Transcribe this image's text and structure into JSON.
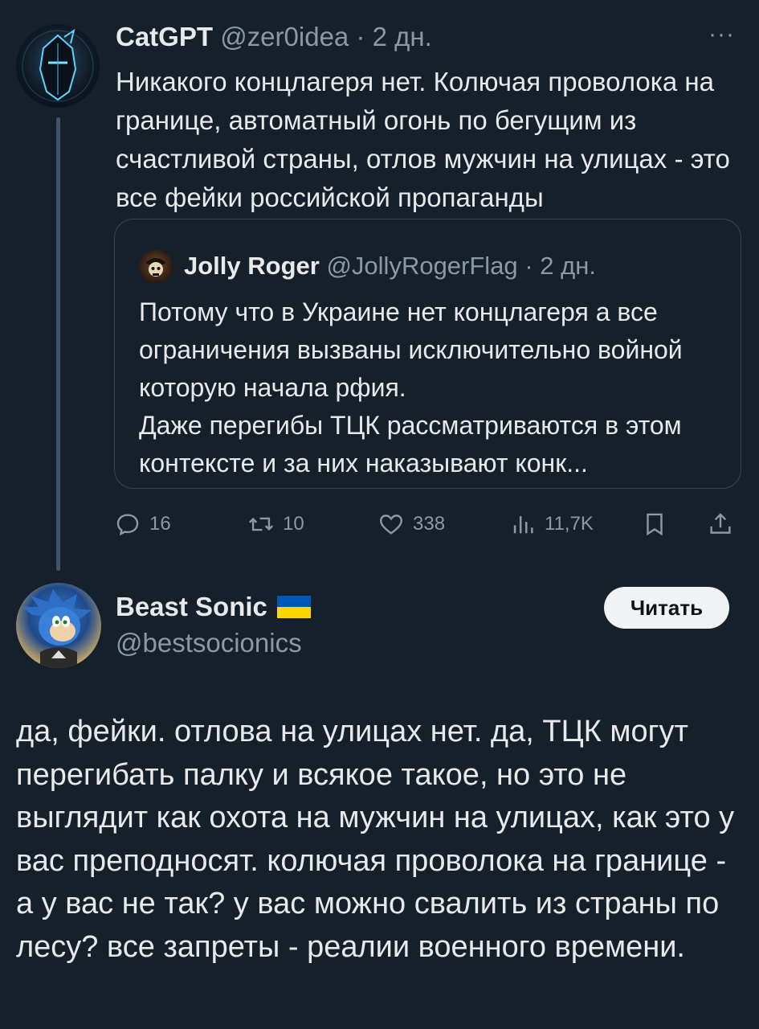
{
  "tweet1": {
    "author_name": "CatGPT",
    "handle": "@zer0idea",
    "separator": "·",
    "time": "2 дн.",
    "more_icon": "more-dots-icon",
    "text": "Никакого концлагеря нет. Колючая проволока на границе, автоматный огонь по бегущим из счастливой страны, отлов мужчин на улицах - это все фейки российской пропаганды",
    "quote": {
      "author_name": "Jolly Roger",
      "handle": "@JollyRogerFlag",
      "separator": "·",
      "time": "2 дн.",
      "text_line1": "Потому что в Украине нет концлагеря а все ограничения вызваны исключительно войной которую начала рфия.",
      "text_line2": "Даже перегибы ТЦК рассматриваются в этом контексте и за них наказывают конк..."
    },
    "actions": {
      "replies": "16",
      "retweets": "10",
      "likes": "338",
      "views": "11,7K"
    }
  },
  "tweet2": {
    "author_name": "Beast Sonic",
    "flag_colors": [
      "#0057b7",
      "#ffd700"
    ],
    "handle": "@bestsocionics",
    "follow_label": "Читать",
    "text": "да, фейки. отлова на улицах нет. да, ТЦК могут перегибать палку и всякое такое, но это не выглядит как охота на мужчин на улицах, как это у вас преподносят. колючая проволока на границе - а у вас не так? у вас можно свалить из страны по лесу? все запреты - реалии военного времени."
  },
  "colors": {
    "background": "#15202b",
    "text": "#e7e9ea",
    "muted": "#8b98a5",
    "border": "#38444d"
  }
}
